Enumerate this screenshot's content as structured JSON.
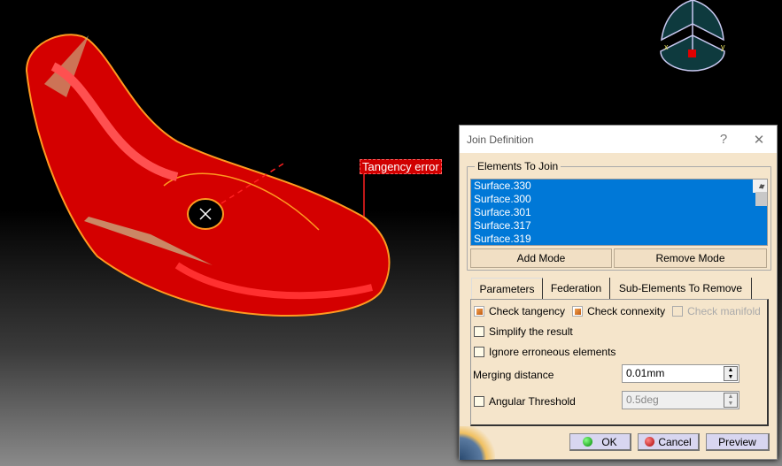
{
  "viewport": {
    "annotation": "Tangency error"
  },
  "compass": {
    "x_label": "x",
    "y_label": "y"
  },
  "dialog": {
    "title": "Join Definition",
    "help": "?",
    "close": "✕",
    "elements_group": "Elements To Join",
    "elements": [
      "Surface.330",
      "Surface.300",
      "Surface.301",
      "Surface.317",
      "Surface.319"
    ],
    "add_mode": "Add Mode",
    "remove_mode": "Remove Mode",
    "tabs": [
      "Parameters",
      "Federation",
      "Sub-Elements To Remove"
    ],
    "params": {
      "check_tangency": {
        "label": "Check tangency",
        "checked": true
      },
      "check_connexity": {
        "label": "Check connexity",
        "checked": true
      },
      "check_manifold": {
        "label": "Check manifold",
        "checked": false,
        "disabled": true
      },
      "simplify": {
        "label": "Simplify the result",
        "checked": false
      },
      "ignore": {
        "label": "Ignore erroneous elements",
        "checked": false
      },
      "merging_label": "Merging distance",
      "merging_value": "0.01mm",
      "angular": {
        "label": "Angular Threshold",
        "checked": false
      },
      "angular_value": "0.5deg"
    },
    "ok": "OK",
    "cancel": "Cancel",
    "preview": "Preview"
  }
}
